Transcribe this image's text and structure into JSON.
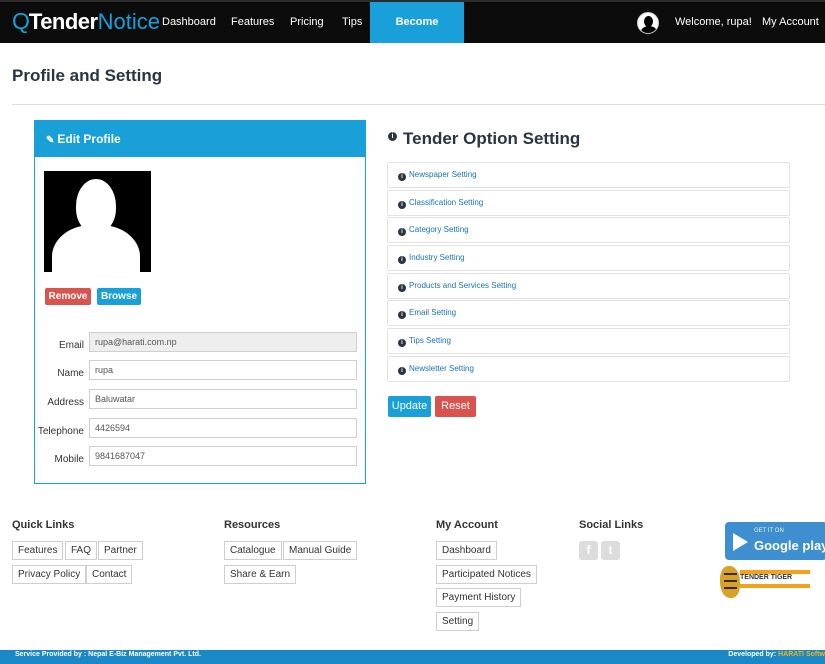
{
  "brand": {
    "logo_q": "Q",
    "logo_tender": "Tender",
    "logo_notice": "Notice",
    "accent": "#1aa0d8",
    "dark": "#0c0c0c"
  },
  "nav": {
    "items": [
      "Dashboard",
      "Features",
      "Pricing",
      "Tips",
      "Become Partner"
    ],
    "welcome": "Welcome, rupa!",
    "my_account": "My Account -"
  },
  "page": {
    "title": "Profile and Setting"
  },
  "edit_profile": {
    "header": "Edit Profile",
    "header_icon": "edit-icon",
    "remove_label": "Remove",
    "browse_label": "Browse",
    "fields": [
      {
        "label": "Email",
        "value": "rupa@harati.com.np"
      },
      {
        "label": "Name",
        "value": "rupa"
      },
      {
        "label": "Address",
        "value": "Baluwatar"
      },
      {
        "label": "Telephone",
        "value": "4426594"
      },
      {
        "label": "Mobile",
        "value": "9841687047"
      }
    ]
  },
  "tender_options": {
    "title": "Tender Option Setting",
    "items": [
      "Newspaper Setting",
      "Classification Setting",
      "Category Setting",
      "Industry Setting",
      "Products and Services Setting",
      "Email Setting",
      "Tips Setting",
      "Newsletter Setting"
    ],
    "update_label": "Update",
    "reset_label": "Reset"
  },
  "footer": {
    "quick_links": {
      "title": "Quick Links",
      "items": [
        "Features",
        "FAQ",
        "Partner",
        "Privacy Policy",
        "Contact"
      ]
    },
    "resources": {
      "title": "Resources",
      "items": [
        "Catalogue",
        "Manual Guide",
        "Share & Earn"
      ]
    },
    "my_account": {
      "title": "My Account",
      "items": [
        "Dashboard",
        "Participated Notices",
        "Payment History",
        "Setting"
      ]
    },
    "social": {
      "title": "Social Links",
      "icons": [
        "facebook-icon",
        "twitter-icon"
      ]
    },
    "google_play": {
      "small": "GET IT ON",
      "big": "Google play"
    },
    "tender_tiger": {
      "name": "TENDER TIGER"
    },
    "bottom_left": "Service Provided by : Nepal E-Biz Management Pvt. Ltd.",
    "bottom_right_prefix": "Developed by:",
    "bottom_right_brand": "HARATI Softw"
  }
}
